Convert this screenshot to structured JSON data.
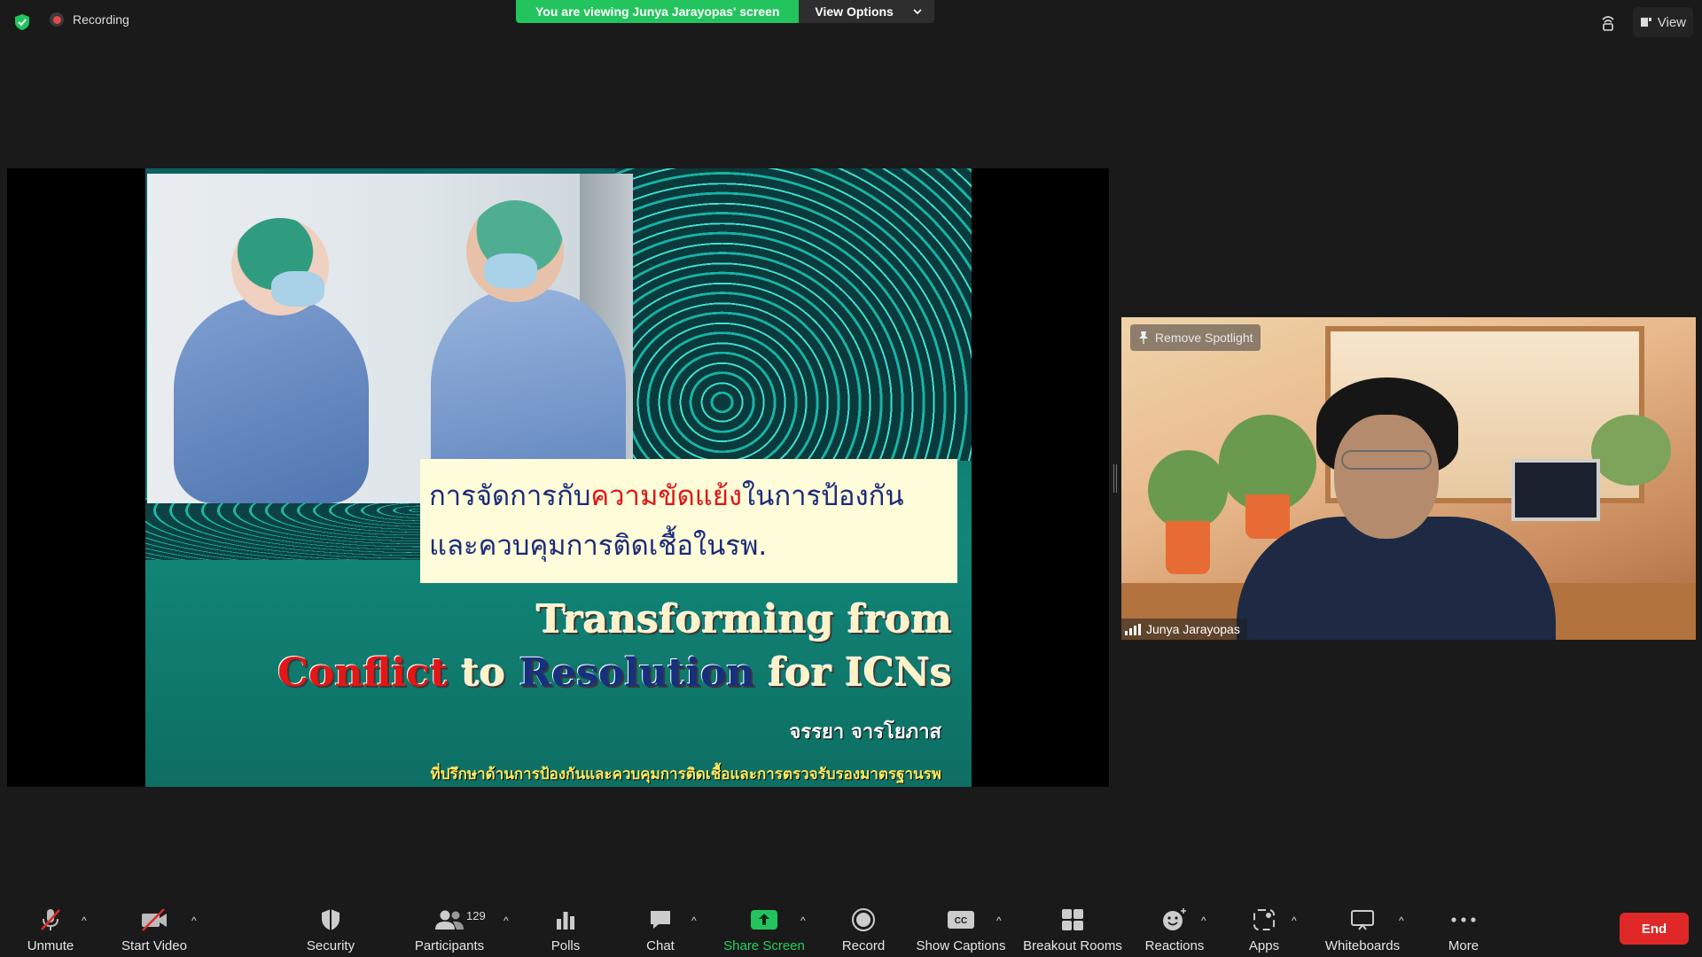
{
  "top_bar": {
    "recording_label": "Recording",
    "viewing_banner": "You are viewing Junya Jarayopas' screen",
    "view_options_label": "View Options",
    "view_label": "View"
  },
  "slide": {
    "thai_title_part1": "การจัดการกับ",
    "thai_title_highlight": "ความขัดแย้ง",
    "thai_title_part2": "ในการป้องกัน",
    "thai_title_line2": "และควบคุมการติดเชื้อในรพ.",
    "english_line1": "Transforming from",
    "english_conflict": "Conflict",
    "english_to": "to",
    "english_resolution": "Resolution",
    "english_for": "for ICNs",
    "author": "จรรยา จารโยภาส",
    "affiliation": "ที่ปรึกษาด้านการป้องกันและควบคุมการติดเชื้อและการตรวจรับรองมาตรฐานรพ"
  },
  "speaker": {
    "remove_spotlight_label": "Remove Spotlight",
    "name": "Junya Jarayopas"
  },
  "toolbar": {
    "unmute": "Unmute",
    "start_video": "Start Video",
    "security": "Security",
    "participants": "Participants",
    "participants_count": "129",
    "polls": "Polls",
    "chat": "Chat",
    "share_screen": "Share Screen",
    "record": "Record",
    "show_captions": "Show Captions",
    "breakout_rooms": "Breakout Rooms",
    "reactions": "Reactions",
    "apps": "Apps",
    "whiteboards": "Whiteboards",
    "more": "More",
    "end": "End"
  },
  "colors": {
    "accent_green": "#23c45e",
    "end_red": "#e02828",
    "background": "#1a1a1a"
  }
}
